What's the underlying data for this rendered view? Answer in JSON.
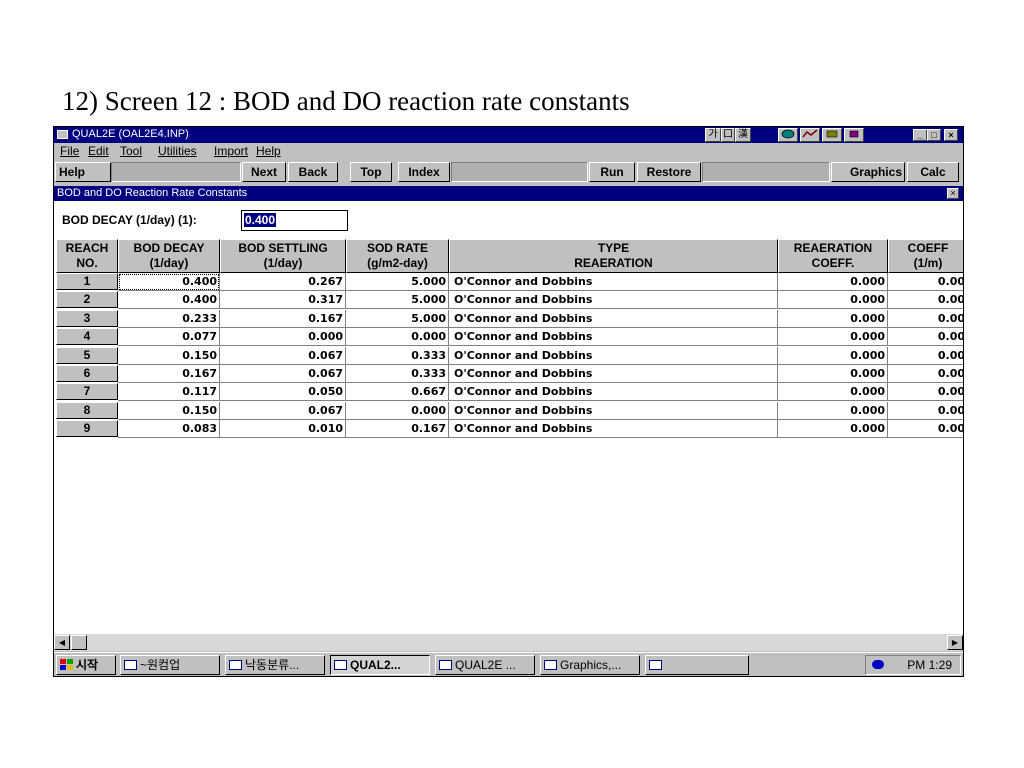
{
  "slide": {
    "title": "12) Screen 12 : BOD and DO reaction rate constants"
  },
  "window": {
    "title": "QUAL2E (OAL2E4.INP)",
    "ime": [
      "가",
      "口",
      "漢"
    ],
    "tray_icons": [
      "globe-icon",
      "chart-icon",
      "tool-icon",
      "speaker-icon"
    ],
    "controls": [
      "minimize",
      "maximize",
      "close"
    ]
  },
  "menu": [
    "File",
    "Edit",
    "Tool",
    "Utilities",
    "Import",
    "Help"
  ],
  "toolbar": {
    "help": "Help",
    "next": "Next",
    "back": "Back",
    "top": "Top",
    "index": "Index",
    "run": "Run",
    "restore": "Restore",
    "graphics": "Graphics",
    "calc": "Calc"
  },
  "panel": {
    "title": "BOD and DO Reaction Rate Constants",
    "decay_label": "BOD DECAY (1/day) (1):",
    "decay_value": "0.400"
  },
  "table": {
    "headers": [
      [
        "REACH",
        "NO."
      ],
      [
        "BOD DECAY",
        "(1/day)"
      ],
      [
        "BOD SETTLING",
        "(1/day)"
      ],
      [
        "SOD RATE",
        "(g/m2-day)"
      ],
      [
        "TYPE",
        "REAERATION"
      ],
      [
        "REAERATION",
        "COEFF."
      ],
      [
        "COEFF",
        "(1/m)"
      ]
    ],
    "rows": [
      {
        "reach": "1",
        "decay": "0.400",
        "settling": "0.267",
        "sod": "5.000",
        "type": "O'Connor and Dobbins",
        "coeff": "0.000",
        "coeff2": "0.00"
      },
      {
        "reach": "2",
        "decay": "0.400",
        "settling": "0.317",
        "sod": "5.000",
        "type": "O'Connor and Dobbins",
        "coeff": "0.000",
        "coeff2": "0.00"
      },
      {
        "reach": "3",
        "decay": "0.233",
        "settling": "0.167",
        "sod": "5.000",
        "type": "O'Connor and Dobbins",
        "coeff": "0.000",
        "coeff2": "0.00"
      },
      {
        "reach": "4",
        "decay": "0.077",
        "settling": "0.000",
        "sod": "0.000",
        "type": "O'Connor and Dobbins",
        "coeff": "0.000",
        "coeff2": "0.00"
      },
      {
        "reach": "5",
        "decay": "0.150",
        "settling": "0.067",
        "sod": "0.333",
        "type": "O'Connor and Dobbins",
        "coeff": "0.000",
        "coeff2": "0.00"
      },
      {
        "reach": "6",
        "decay": "0.167",
        "settling": "0.067",
        "sod": "0.333",
        "type": "O'Connor and Dobbins",
        "coeff": "0.000",
        "coeff2": "0.00"
      },
      {
        "reach": "7",
        "decay": "0.117",
        "settling": "0.050",
        "sod": "0.667",
        "type": "O'Connor and Dobbins",
        "coeff": "0.000",
        "coeff2": "0.00"
      },
      {
        "reach": "8",
        "decay": "0.150",
        "settling": "0.067",
        "sod": "0.000",
        "type": "O'Connor and Dobbins",
        "coeff": "0.000",
        "coeff2": "0.00"
      },
      {
        "reach": "9",
        "decay": "0.083",
        "settling": "0.010",
        "sod": "0.167",
        "type": "O'Connor and Dobbins",
        "coeff": "0.000",
        "coeff2": "0.00"
      }
    ]
  },
  "taskbar": {
    "start": "시작",
    "items": [
      "~원컴업",
      "낙동분류...",
      "QUAL2...",
      "QUAL2E ...",
      "Graphics,...",
      ""
    ],
    "clock": "PM 1:29"
  },
  "colors": {
    "titlebar": "#000080",
    "chrome": "#c0c0c0",
    "selection": "#000080"
  }
}
